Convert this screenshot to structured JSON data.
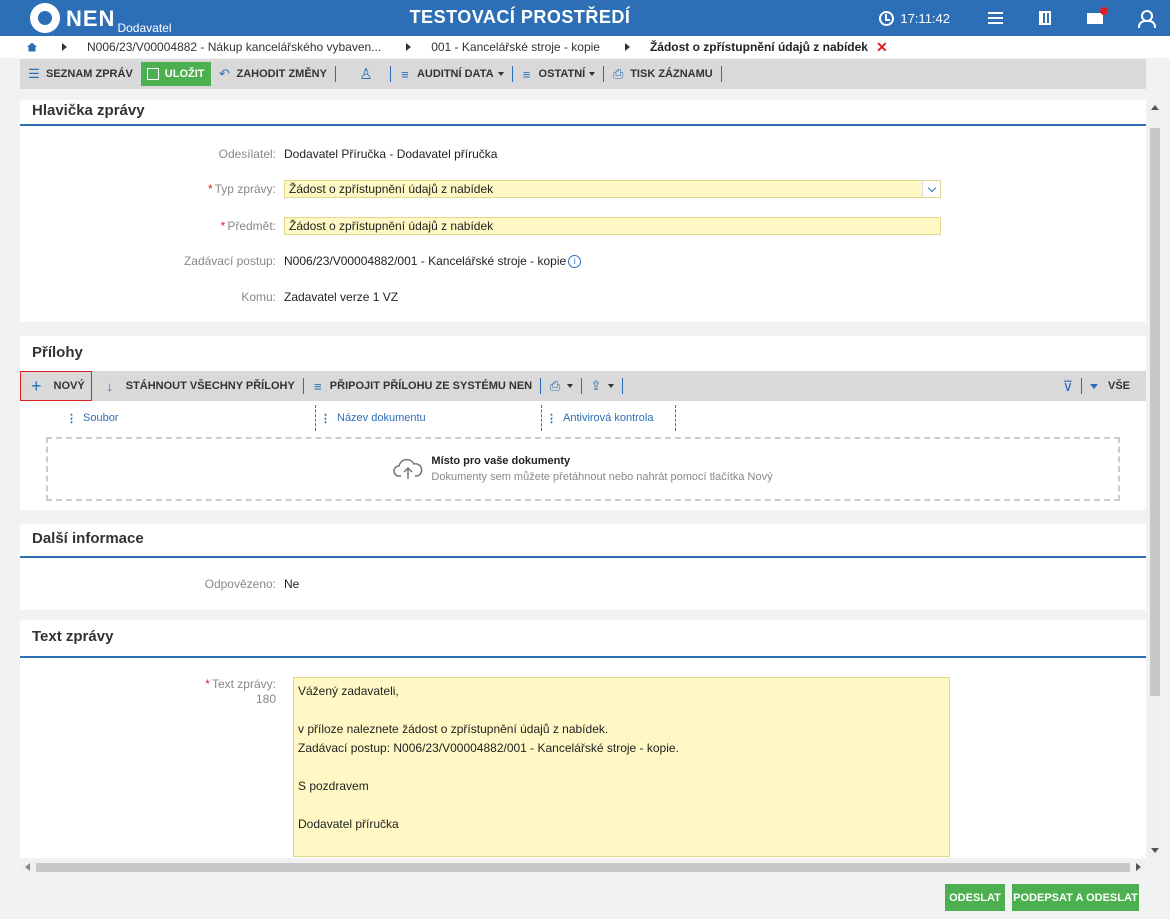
{
  "app": {
    "logo": "NEN",
    "logo_sub": "Dodavatel",
    "env_title": "TESTOVACÍ PROSTŘEDÍ",
    "time": "17:11:42"
  },
  "breadcrumb": {
    "items": [
      "N006/23/V00004882 - Nákup kancelářského vybaven...",
      "001 - Kancelářské stroje - kopie",
      "Žádost o zpřístupnění údajů z nabídek"
    ],
    "close": "✕"
  },
  "toolbar": {
    "list": "SEZNAM ZPRÁV",
    "save": "ULOŽIT",
    "discard": "ZAHODIT ZMĚNY",
    "audit": "AUDITNÍ DATA",
    "other": "OSTATNÍ",
    "print": "TISK ZÁZNAMU"
  },
  "header_section": {
    "title": "Hlavička zprávy",
    "sender_label": "Odesílatel:",
    "sender_value": "Dodavatel Příručka - Dodavatel příručka",
    "type_label": "Typ zprávy:",
    "type_value": "Žádost o zpřístupnění údajů z nabídek",
    "subject_label": "Předmět:",
    "subject_value": "Žádost o zpřístupnění údajů z nabídek",
    "procedure_label": "Zadávací postup:",
    "procedure_value": "N006/23/V00004882/001 - Kancelářské stroje - kopie",
    "to_label": "Komu:",
    "to_value": "Zadavatel verze 1 VZ"
  },
  "attachments": {
    "title": "Přílohy",
    "new": "NOVÝ",
    "download_all": "STÁHNOUT VŠECHNY PŘÍLOHY",
    "attach_system": "PŘIPOJIT PŘÍLOHU ZE SYSTÉMU NEN",
    "all": "VŠE",
    "columns": [
      "Soubor",
      "Název dokumentu",
      "Antivirová kontrola"
    ],
    "drop_title": "Místo pro vaše dokumenty",
    "drop_sub": "Dokumenty sem můžete přetáhnout nebo nahrát pomocí tlačítka Nový"
  },
  "more_info": {
    "title": "Další informace",
    "answered_label": "Odpovězeno:",
    "answered_value": "Ne"
  },
  "message_text": {
    "title": "Text zprávy",
    "label": "Text zprávy:",
    "count": "180",
    "body": "Vážený zadavateli,\n\nv příloze naleznete žádost o zpřístupnění údajů z nabídek.\nZadávací postup: N006/23/V00004882/001 - Kancelářské stroje - kopie.\n\nS pozdravem\n\nDodavatel příručka"
  },
  "footer": {
    "send": "ODESLAT",
    "sign_send": "PODEPSAT A ODESLAT"
  },
  "colors": {
    "brand_blue": "#2c6fb7",
    "green": "#4caf50",
    "required": "#e02020",
    "field_yellow": "#fff8c4"
  }
}
